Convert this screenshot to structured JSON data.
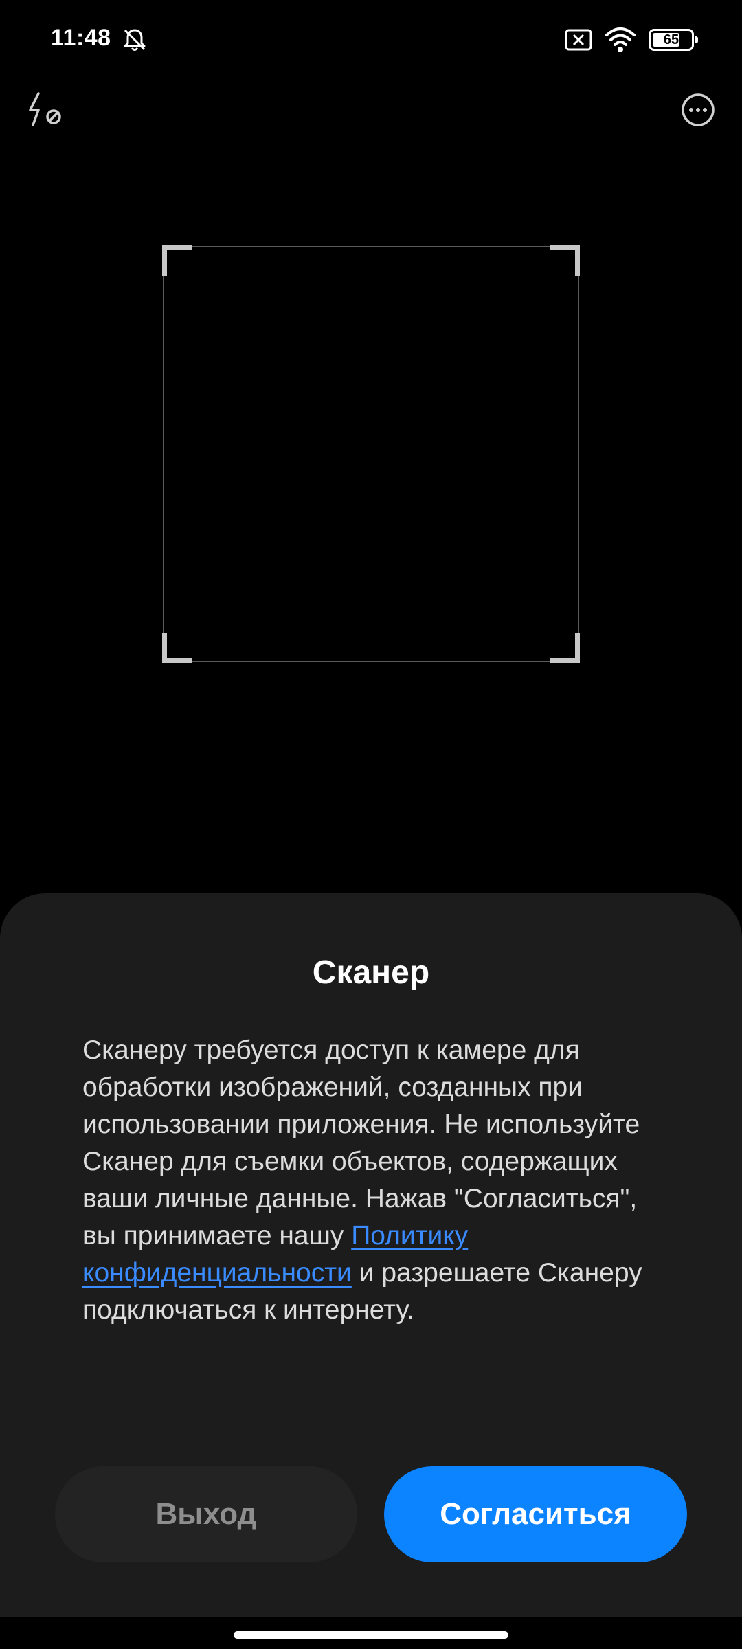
{
  "status_bar": {
    "time": "11:48",
    "battery_level": "65",
    "icons": [
      "bell-off-icon",
      "x-box-icon",
      "wifi-icon",
      "battery-icon"
    ]
  },
  "toolbar": {
    "flash_icon": "flash-off-icon",
    "more_icon": "more-options-icon"
  },
  "dialog": {
    "title": "Сканер",
    "body_part1": "Сканеру требуется доступ к камере для обработки изображений, созданных при использовании приложения. Не используйте Сканер для съемки объектов, содержащих ваши личные данные. Нажав \"Согласиться\", вы принимаете нашу ",
    "privacy_link": "Политику конфиденциальности",
    "body_part2": " и разрешаете Сканеру подключаться к интернету.",
    "exit_button": "Выход",
    "agree_button": "Согласиться"
  },
  "colors": {
    "accent": "#0d84ff",
    "link": "#3a8bff",
    "sheet_bg": "#1c1c1c"
  }
}
